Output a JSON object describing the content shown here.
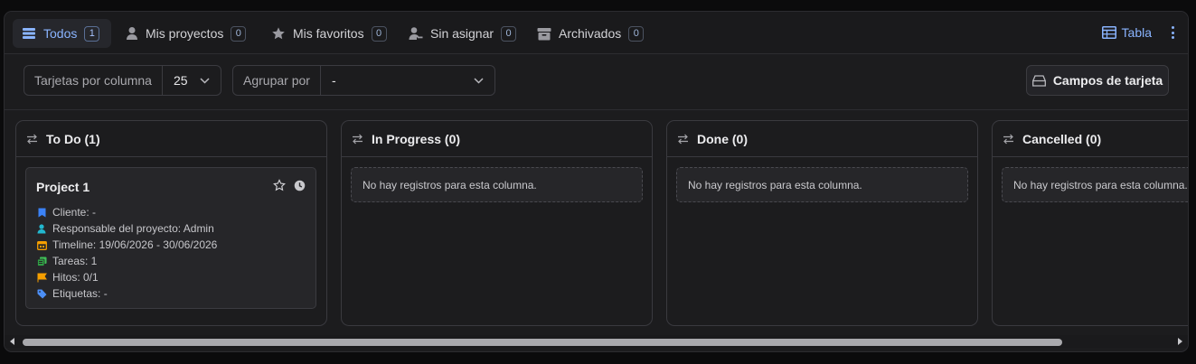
{
  "tabs": [
    {
      "label": "Todos",
      "count": "1",
      "icon": "list-icon",
      "active": true
    },
    {
      "label": "Mis proyectos",
      "count": "0",
      "icon": "user-icon"
    },
    {
      "label": "Mis favoritos",
      "count": "0",
      "icon": "star-icon"
    },
    {
      "label": "Sin asignar",
      "count": "0",
      "icon": "user-minus-icon"
    },
    {
      "label": "Archivados",
      "count": "0",
      "icon": "archive-icon"
    }
  ],
  "view": {
    "label": "Tabla",
    "icon": "table-icon"
  },
  "filters": {
    "cards_per_column_label": "Tarjetas por columna",
    "cards_per_column_value": "25",
    "group_by_label": "Agrupar por",
    "group_by_value": "-",
    "card_fields_label": "Campos de tarjeta"
  },
  "columns": [
    {
      "title": "To Do (1)"
    },
    {
      "title": "In Progress (0)",
      "empty_text": "No hay registros para esta columna."
    },
    {
      "title": "Done (0)",
      "empty_text": "No hay registros para esta columna."
    },
    {
      "title": "Cancelled (0)",
      "empty_text": "No hay registros para esta columna."
    }
  ],
  "card": {
    "title": "Project 1",
    "rows": [
      {
        "text": "Cliente: -",
        "icon": "building-icon",
        "color": "#3b82f6"
      },
      {
        "text": "Responsable del proyecto: Admin",
        "icon": "user-icon",
        "color": "#22b8cf"
      },
      {
        "text": "Timeline: 19/06/2026 - 30/06/2026",
        "icon": "calendar-icon",
        "color": "#f59f00"
      },
      {
        "text": "Tareas: 1",
        "icon": "tasks-icon",
        "color": "#40c057"
      },
      {
        "text": "Hitos: 0/1",
        "icon": "flag-icon",
        "color": "#f59f00"
      },
      {
        "text": "Etiquetas: -",
        "icon": "tag-icon",
        "color": "#4c8ff7"
      }
    ]
  },
  "colors": {
    "accent": "#8ab4ff",
    "background": "#1c1c1e"
  }
}
